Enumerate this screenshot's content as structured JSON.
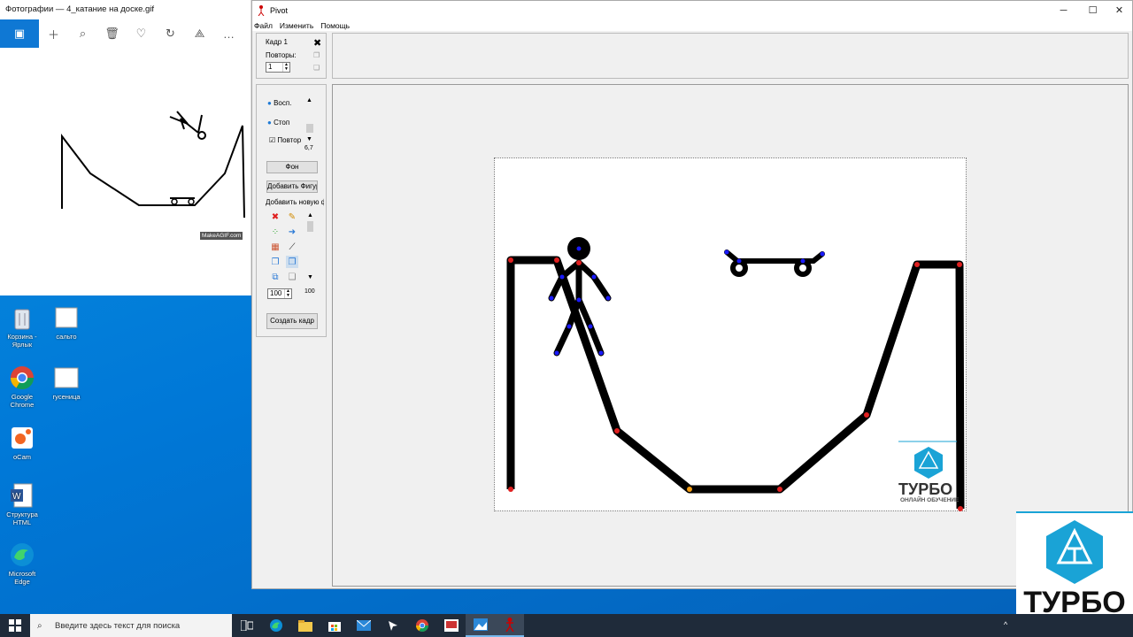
{
  "photos": {
    "title": "Фотографии — 4_катание на доске.gif",
    "watermark": "MakeAGIF.com"
  },
  "desktop": {
    "icons": [
      {
        "label": "Корзина - Ярлык",
        "icon": "recycle-bin-icon"
      },
      {
        "label": "сальто",
        "icon": "file-icon"
      },
      {
        "label": "Google Chrome",
        "icon": "chrome-icon"
      },
      {
        "label": "гусеница",
        "icon": "file-icon"
      },
      {
        "label": "oCam",
        "icon": "ocam-icon"
      },
      {
        "label": "Структура HTML",
        "icon": "word-doc-icon"
      },
      {
        "label": "Microsoft Edge",
        "icon": "edge-icon"
      }
    ]
  },
  "pivot": {
    "title": "Pivot",
    "menu": [
      "Файл",
      "Изменить",
      "Помощь"
    ],
    "frame": {
      "label": "Кадр 1",
      "repeats_label": "Повторы:",
      "repeats_value": "1"
    },
    "playback": {
      "play": "Восп.",
      "stop": "Стоп",
      "repeat": "Повтор",
      "speed": "6,7"
    },
    "buttons": {
      "background": "Фон",
      "add_figure": "Добавить Фигуру",
      "add_new": "Добавить новую ф",
      "create_frame": "Создать кадр"
    },
    "size": {
      "value": "100",
      "max": "100"
    }
  },
  "brand": {
    "name": "ТУРБО",
    "sub": "ОНЛАЙН ОБУЧЕНИЕ"
  },
  "taskbar": {
    "search_placeholder": "Введите здесь текст для поиска"
  },
  "colors": {
    "accent": "#0078d7",
    "brand": "#1aa3d6",
    "joint_red": "#e02020",
    "joint_blue": "#1a1aff"
  }
}
